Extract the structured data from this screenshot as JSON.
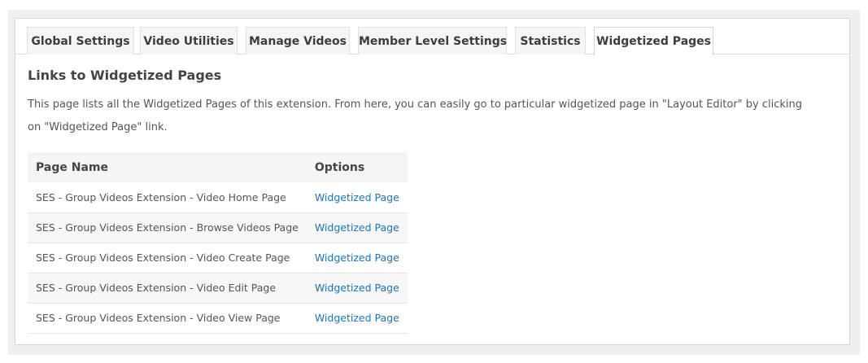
{
  "tabs": [
    {
      "label": "Global Settings"
    },
    {
      "label": "Video Utilities"
    },
    {
      "label": "Manage Videos"
    },
    {
      "label": "Member Level Settings"
    },
    {
      "label": "Statistics"
    },
    {
      "label": "Widgetized Pages",
      "active": true
    }
  ],
  "section": {
    "title": "Links to Widgetized Pages",
    "description": "This page lists all the Widgetized Pages of this extension. From here, you can easily go to particular widgetized page in \"Layout Editor\" by clicking on \"Widgetized Page\" link."
  },
  "table": {
    "columns": [
      "Page Name",
      "Options"
    ],
    "rows": [
      {
        "name": "SES - Group Videos Extension - Video Home Page",
        "option": "Widgetized Page"
      },
      {
        "name": "SES - Group Videos Extension - Browse Videos Page",
        "option": "Widgetized Page"
      },
      {
        "name": "SES - Group Videos Extension - Video Create Page",
        "option": "Widgetized Page"
      },
      {
        "name": "SES - Group Videos Extension - Video Edit Page",
        "option": "Widgetized Page"
      },
      {
        "name": "SES - Group Videos Extension - Video View Page",
        "option": "Widgetized Page"
      }
    ]
  },
  "colors": {
    "link": "#1e73be",
    "outer_background": "#efefef",
    "header_background": "#f5f5f5"
  }
}
